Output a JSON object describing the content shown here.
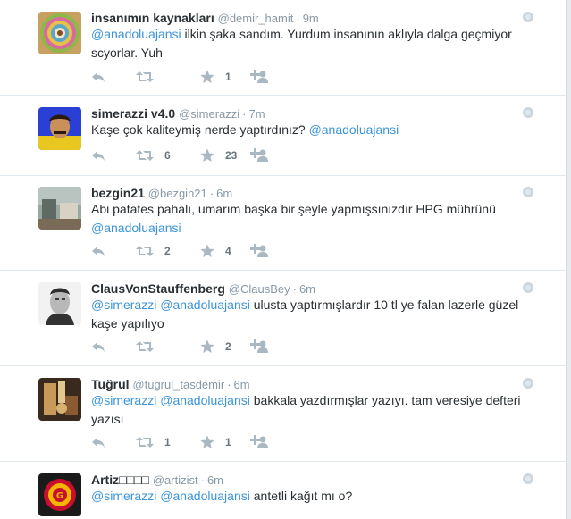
{
  "tweets": [
    {
      "name": "insanımın kaynakları",
      "handle": "@demir_hamit",
      "time": "9m",
      "line1_parts": [
        "@anadoluajansi",
        " ilkin şaka sandım. Yurdum insanının aklıyla dalga geçmiyor"
      ],
      "line2_parts": [
        "scyorlar. Yuh"
      ],
      "retweets": "",
      "favorites": "1"
    },
    {
      "name": "simerazzi v4.0",
      "handle": "@simerazzi",
      "time": "7m",
      "line1_parts": [
        "Kaşe çok kaliteymiş nerde yaptırdınız? ",
        "@anadoluajansi"
      ],
      "line2_parts": [],
      "retweets": "6",
      "favorites": "23"
    },
    {
      "name": "bezgin21",
      "handle": "@bezgin21",
      "time": "6m",
      "line1_parts": [
        "Abi patates pahalı, umarım başka bir şeyle yapmışsınızdır HPG mührünü"
      ],
      "line2_parts": [
        "@anadoluajansi"
      ],
      "retweets": "2",
      "favorites": "4"
    },
    {
      "name": "ClausVonStauffenberg",
      "handle": "@ClausBey",
      "time": "6m",
      "line1_parts": [
        "@simerazzi",
        " ",
        "@anadoluajansi",
        " ulusta yaptırmışlardır 10 tl ye falan lazerle güzel"
      ],
      "line2_parts": [
        "kaşe yapılıyo"
      ],
      "retweets": "",
      "favorites": "2"
    },
    {
      "name": "Tuğrul",
      "handle": "@tugrul_tasdemir",
      "time": "6m",
      "line1_parts": [
        "@simerazzi",
        " ",
        "@anadoluajansi",
        " bakkala yazdırmışlar yazıyı. tam veresiye defteri"
      ],
      "line2_parts": [
        "yazısı"
      ],
      "retweets": "1",
      "favorites": "1"
    },
    {
      "name": "Artiz□□□□",
      "handle": "@artizist",
      "time": "6m",
      "line1_parts": [
        "@simerazzi",
        " ",
        "@anadoluajansi",
        " antetli kağıt mı o?"
      ],
      "line2_parts": [],
      "retweets": "",
      "favorites": ""
    }
  ],
  "icons": {
    "reply": "reply-icon",
    "retweet": "retweet-icon",
    "favorite": "star-icon",
    "follow": "follow-icon",
    "more": "more-options-icon"
  },
  "colors": {
    "mention": "#3b94d9",
    "muted": "#8899a6",
    "action": "#aab8c2",
    "count": "#66757f",
    "divider": "#e1e8ed"
  }
}
